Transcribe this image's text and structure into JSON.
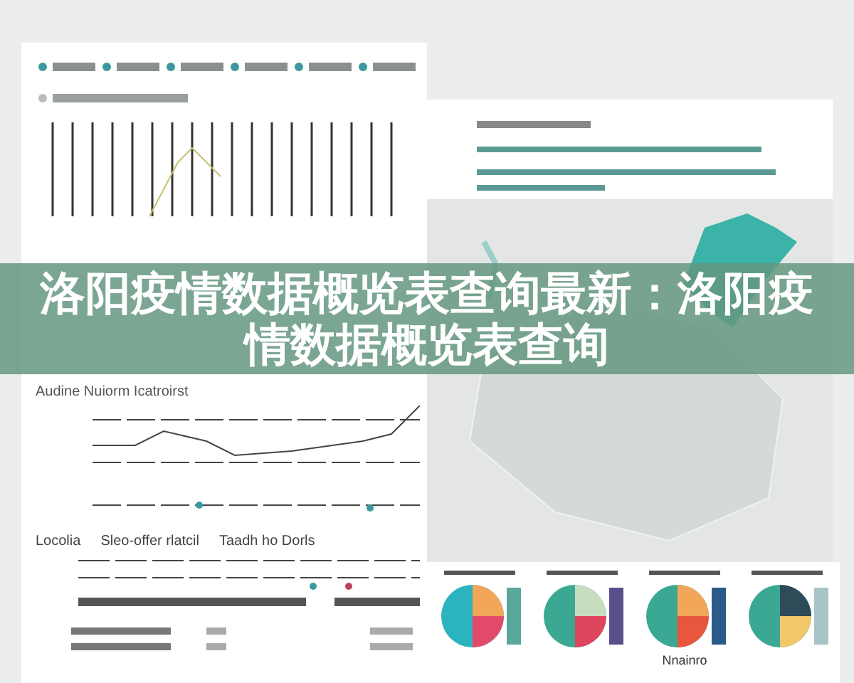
{
  "banner": {
    "title": "洛阳疫情数据概览表查询最新：洛阳疫情数据概览表查询"
  },
  "line_panel": {
    "title": "Audine Nuiorm Icatroirst"
  },
  "bar_panel": {
    "labels": [
      "Locolia",
      "Sleo-offer rlatcil",
      "Taadh ho Dorls"
    ]
  },
  "pie_row": {
    "label": "Nnainro"
  }
}
